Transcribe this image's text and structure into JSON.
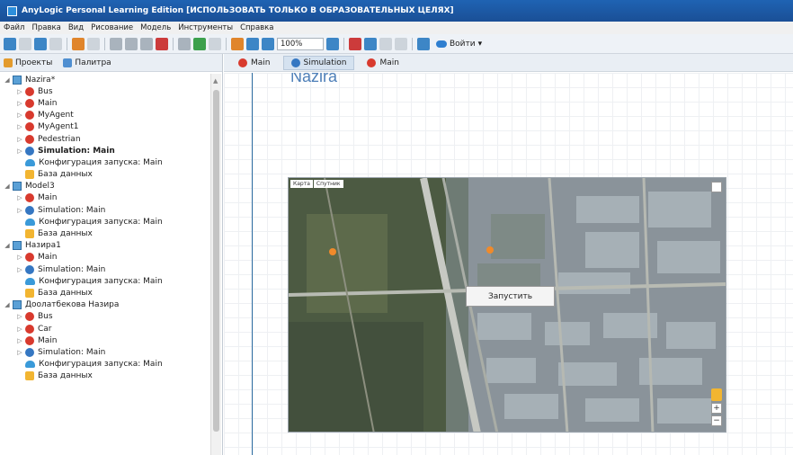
{
  "window": {
    "title": "AnyLogic Personal Learning Edition [ИСПОЛЬЗОВАТЬ ТОЛЬКО В ОБРАЗОВАТЕЛЬНЫХ ЦЕЛЯХ]"
  },
  "menu": [
    "Файл",
    "Правка",
    "Вид",
    "Рисование",
    "Модель",
    "Инструменты",
    "Справка"
  ],
  "toolbar": {
    "zoom": "100%",
    "login": "Войти"
  },
  "left_tabs": [
    {
      "label": "Проекты"
    },
    {
      "label": "Палитра"
    }
  ],
  "tree": [
    {
      "label": "Nazira*",
      "icon": "project",
      "depth": 0,
      "toggle": "open",
      "bold": false
    },
    {
      "label": "Bus",
      "icon": "agent",
      "depth": 1,
      "toggle": "closed",
      "bold": false
    },
    {
      "label": "Main",
      "icon": "agent",
      "depth": 1,
      "toggle": "closed",
      "bold": false
    },
    {
      "label": "MyAgent",
      "icon": "agent",
      "depth": 1,
      "toggle": "closed",
      "bold": false
    },
    {
      "label": "MyAgent1",
      "icon": "agent",
      "depth": 1,
      "toggle": "closed",
      "bold": false
    },
    {
      "label": "Pedestrian",
      "icon": "agent",
      "depth": 1,
      "toggle": "closed",
      "bold": false
    },
    {
      "label": "Simulation: Main",
      "icon": "sim",
      "depth": 1,
      "toggle": "closed",
      "bold": true
    },
    {
      "label": "Конфигурация запуска: Main",
      "icon": "config",
      "depth": 1,
      "toggle": "none",
      "bold": false
    },
    {
      "label": "База данных",
      "icon": "db",
      "depth": 1,
      "toggle": "none",
      "bold": false
    },
    {
      "label": "Model3",
      "icon": "project",
      "depth": 0,
      "toggle": "open",
      "bold": false
    },
    {
      "label": "Main",
      "icon": "agent",
      "depth": 1,
      "toggle": "closed",
      "bold": false
    },
    {
      "label": "Simulation: Main",
      "icon": "sim",
      "depth": 1,
      "toggle": "closed",
      "bold": false
    },
    {
      "label": "Конфигурация запуска: Main",
      "icon": "config",
      "depth": 1,
      "toggle": "none",
      "bold": false
    },
    {
      "label": "База данных",
      "icon": "db",
      "depth": 1,
      "toggle": "none",
      "bold": false
    },
    {
      "label": "Назира1",
      "icon": "project",
      "depth": 0,
      "toggle": "open",
      "bold": false
    },
    {
      "label": "Main",
      "icon": "agent",
      "depth": 1,
      "toggle": "closed",
      "bold": false
    },
    {
      "label": "Simulation: Main",
      "icon": "sim",
      "depth": 1,
      "toggle": "closed",
      "bold": false
    },
    {
      "label": "Конфигурация запуска: Main",
      "icon": "config",
      "depth": 1,
      "toggle": "none",
      "bold": false
    },
    {
      "label": "База данных",
      "icon": "db",
      "depth": 1,
      "toggle": "none",
      "bold": false
    },
    {
      "label": "Доолатбекова Назира",
      "icon": "project",
      "depth": 0,
      "toggle": "open",
      "bold": false
    },
    {
      "label": "Bus",
      "icon": "agent",
      "depth": 1,
      "toggle": "closed",
      "bold": false
    },
    {
      "label": "Car",
      "icon": "agent",
      "depth": 1,
      "toggle": "closed",
      "bold": false
    },
    {
      "label": "Main",
      "icon": "agent",
      "depth": 1,
      "toggle": "closed",
      "bold": false
    },
    {
      "label": "Simulation: Main",
      "icon": "sim",
      "depth": 1,
      "toggle": "closed",
      "bold": false
    },
    {
      "label": "Конфигурация запуска: Main",
      "icon": "config",
      "depth": 1,
      "toggle": "none",
      "bold": false
    },
    {
      "label": "База данных",
      "icon": "db",
      "depth": 1,
      "toggle": "none",
      "bold": false
    }
  ],
  "editor_tabs": [
    {
      "label": "Main",
      "icon": "agent",
      "active": false
    },
    {
      "label": "Simulation",
      "icon": "sim",
      "active": true
    },
    {
      "label": "Main",
      "icon": "agent",
      "active": false
    }
  ],
  "canvas": {
    "label": "Nazira",
    "map_buttons": [
      "Карта",
      "Спутник"
    ],
    "run_button": "Запустить"
  },
  "colors": {
    "titlebar": "#1a4f96",
    "agent": "#d83a2e",
    "simulation": "#3577c2",
    "database": "#f2b531",
    "canvas_label": "#4e7fb8"
  }
}
